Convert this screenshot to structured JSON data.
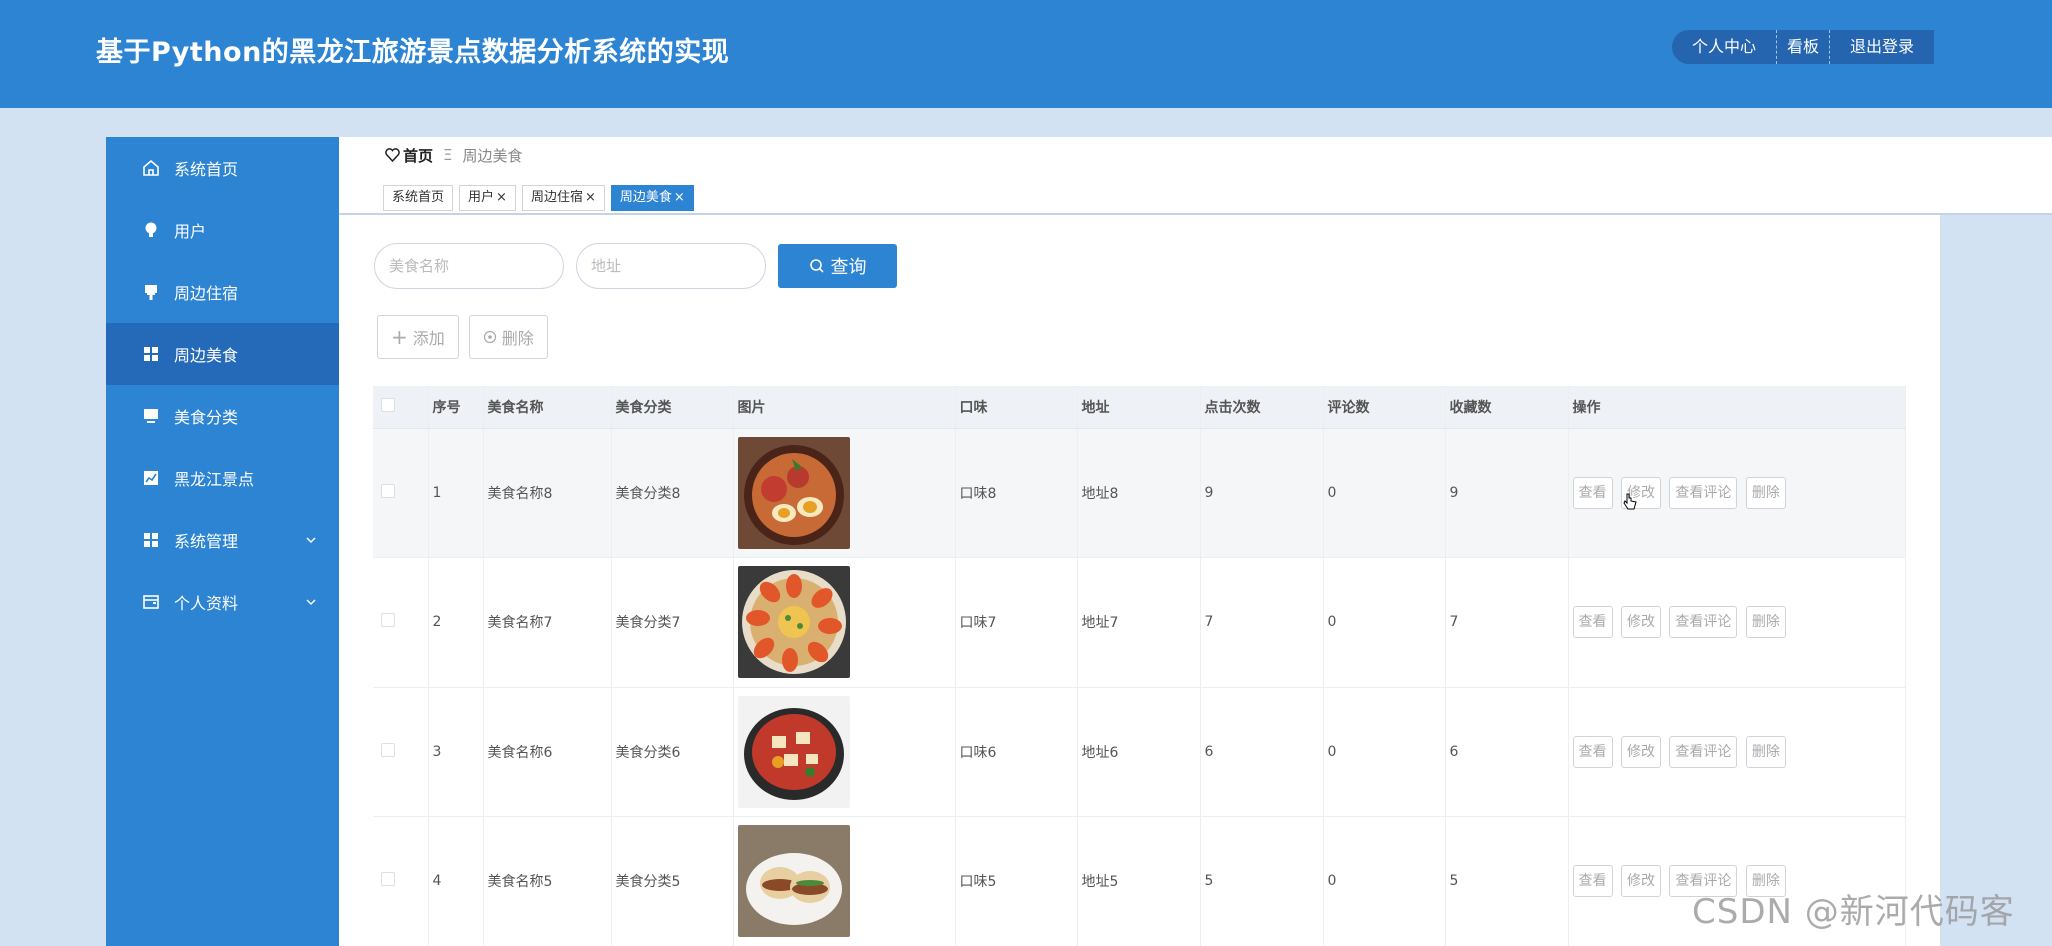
{
  "header": {
    "title": "基于Python的黑龙江旅游景点数据分析系统的实现",
    "nav": [
      "个人中心",
      "看板",
      "退出登录"
    ]
  },
  "sidebar": {
    "items": [
      {
        "label": "系统首页",
        "icon": "home-icon"
      },
      {
        "label": "用户",
        "icon": "bulb-icon"
      },
      {
        "label": "周边住宿",
        "icon": "stamp-icon"
      },
      {
        "label": "周边美食",
        "icon": "grid-icon",
        "active": true
      },
      {
        "label": "美食分类",
        "icon": "monitor-icon"
      },
      {
        "label": "黑龙江景点",
        "icon": "chart-icon"
      },
      {
        "label": "系统管理",
        "icon": "grid-icon",
        "expandable": true
      },
      {
        "label": "个人资料",
        "icon": "wallet-icon",
        "expandable": true
      }
    ]
  },
  "breadcrumb": {
    "home": "首页",
    "separator": "Ξ",
    "current": "周边美食"
  },
  "tabs": [
    {
      "label": "系统首页",
      "closable": false
    },
    {
      "label": "用户",
      "closable": true
    },
    {
      "label": "周边住宿",
      "closable": true
    },
    {
      "label": "周边美食",
      "closable": true,
      "active": true
    }
  ],
  "search": {
    "name_placeholder": "美食名称",
    "address_placeholder": "地址",
    "button_label": "查询"
  },
  "actions": {
    "add_label": "添加",
    "delete_label": "删除"
  },
  "table": {
    "headers": [
      "序号",
      "美食名称",
      "美食分类",
      "图片",
      "口味",
      "地址",
      "点击次数",
      "评论数",
      "收藏数",
      "操作"
    ],
    "op_labels": [
      "查看",
      "修改",
      "查看评论",
      "删除"
    ],
    "rows": [
      {
        "no": "1",
        "name": "美食名称8",
        "category": "美食分类8",
        "image": "ramen",
        "taste": "口味8",
        "address": "地址8",
        "clicks": "9",
        "comments": "0",
        "favorites": "9"
      },
      {
        "no": "2",
        "name": "美食名称7",
        "category": "美食分类7",
        "image": "shrimp-plate",
        "taste": "口味7",
        "address": "地址7",
        "clicks": "7",
        "comments": "0",
        "favorites": "7"
      },
      {
        "no": "3",
        "name": "美食名称6",
        "category": "美食分类6",
        "image": "stew-bowl",
        "taste": "口味6",
        "address": "地址6",
        "clicks": "6",
        "comments": "0",
        "favorites": "6"
      },
      {
        "no": "4",
        "name": "美食名称5",
        "category": "美食分类5",
        "image": "burger-bun",
        "taste": "口味5",
        "address": "地址5",
        "clicks": "5",
        "comments": "0",
        "favorites": "5"
      }
    ]
  },
  "watermark": "CSDN @新河代码客",
  "colors": {
    "primary": "#2c84d3",
    "active_menu": "#2569b9",
    "page_bg": "#d3e2f2"
  }
}
